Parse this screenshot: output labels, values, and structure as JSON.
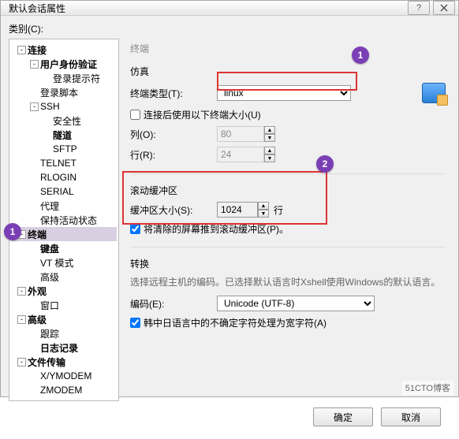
{
  "window_title": "默认会话属性",
  "category_label": "类别(C):",
  "tree": {
    "connection": "连接",
    "user_auth": "用户身份验证",
    "login_prompt": "登录提示符",
    "login_script": "登录脚本",
    "ssh": "SSH",
    "security": "安全性",
    "tunnel": "隧道",
    "sftp": "SFTP",
    "telnet": "TELNET",
    "rlogin": "RLOGIN",
    "serial": "SERIAL",
    "proxy": "代理",
    "keep_alive": "保持活动状态",
    "terminal": "终端",
    "keyboard": "键盘",
    "vt_mode": "VT 模式",
    "advanced": "高级",
    "appearance": "外观",
    "window": "窗口",
    "advanced2": "高级",
    "trace": "跟踪",
    "logging": "日志记录",
    "file_transfer": "文件传输",
    "xymodem": "X/YMODEM",
    "zmodem": "ZMODEM"
  },
  "section_terminal": "终端",
  "emulation": {
    "title": "仿真",
    "type_label": "终端类型(T):",
    "type_value": "linux",
    "use_size_label": "连接后使用以下终端大小(U)",
    "cols_label": "列(O):",
    "cols_value": "80",
    "rows_label": "行(R):",
    "rows_value": "24"
  },
  "scrollback": {
    "title": "滚动缓冲区",
    "size_label": "缓冲区大小(S):",
    "size_value": "1024",
    "unit": "行",
    "push_label": "将清除的屏幕推到滚动缓冲区(P)。"
  },
  "conversion": {
    "title": "转换",
    "desc": "选择远程主机的编码。已选择默认语言时Xshell使用Windows的默认语言。",
    "encoding_label": "编码(E):",
    "encoding_value": "Unicode (UTF-8)",
    "cjk_label": "韩中日语言中的不确定字符处理为宽字符(A)"
  },
  "footer": {
    "ok": "确定",
    "cancel": "取消"
  },
  "callouts": {
    "one": "1",
    "two": "2"
  },
  "watermark": "51CTO博客"
}
